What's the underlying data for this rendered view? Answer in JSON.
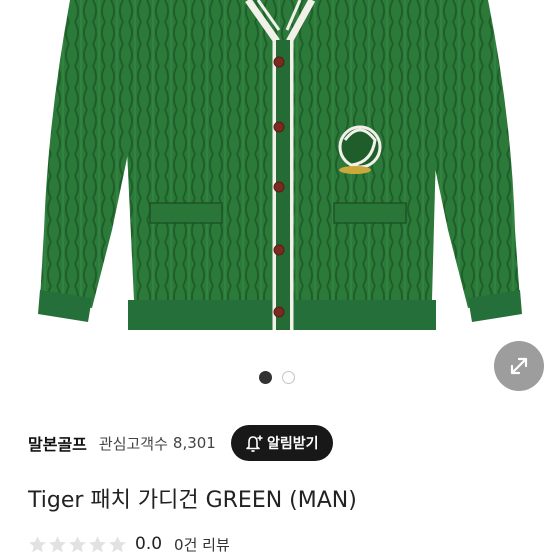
{
  "product_image": {
    "alt": "Green cable-knit cardigan with white trim and tiger patch",
    "colors": {
      "knit": "#2c7a3a",
      "knit_dark": "#1f5e2a",
      "trim": "#f1f1ea",
      "button": "#7a2a1e"
    }
  },
  "gallery": {
    "expand_icon": "expand-arrows-icon",
    "page_count": 2,
    "current_page": 1
  },
  "seller": {
    "name": "말본골프",
    "favorite_label": "관심고객수",
    "favorite_count": "8,301",
    "alarm_label": "알림받기",
    "alarm_icon": "bell-plus-icon"
  },
  "product": {
    "title": "Tiger 패치 가디건 GREEN (MAN)",
    "rating_value": "0.0",
    "review_count": "0건 리뷰",
    "rating_max_stars": 5,
    "rating_filled_stars": 0
  }
}
